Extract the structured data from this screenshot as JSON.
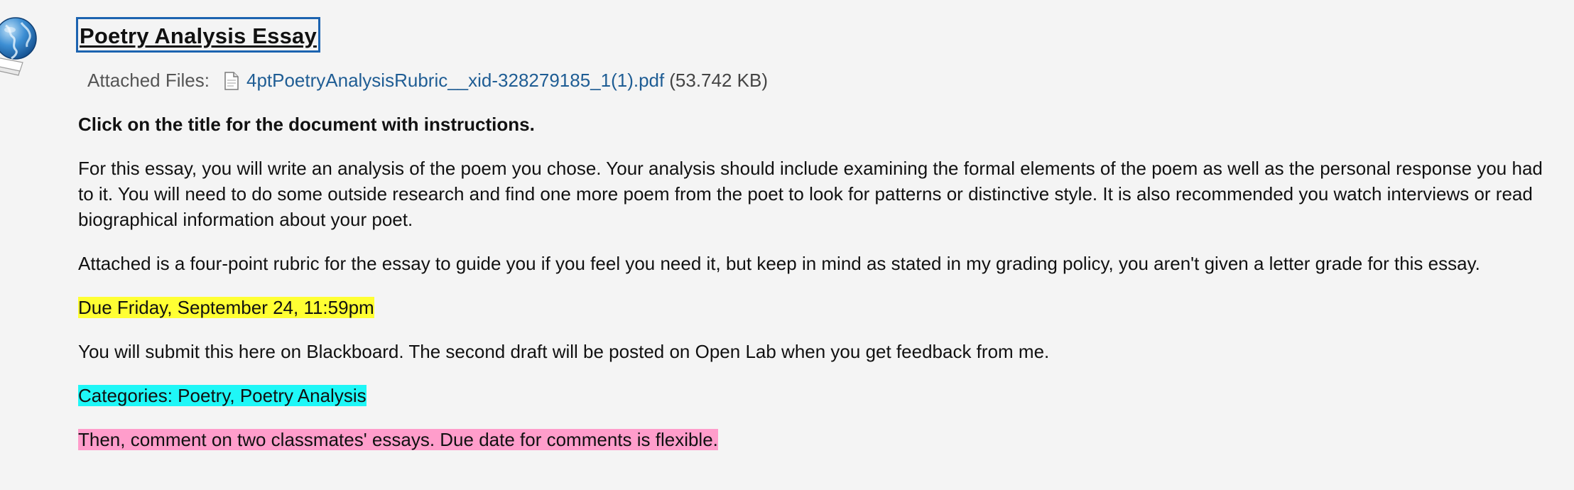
{
  "item": {
    "icon": "globe-document-icon",
    "title": "Poetry Analysis Essay"
  },
  "attachment": {
    "label": "Attached Files:",
    "file_icon": "file-icon",
    "file_name": "4ptPoetryAnalysisRubric__xid-328279185_1(1).pdf",
    "file_size": "(53.742 KB)"
  },
  "body": {
    "instruction": "Click on the title for the document with instructions.",
    "paragraph1": "For this essay, you will write an analysis of the poem you chose. Your analysis should include examining the formal elements of the poem as well as the personal response you had to it. You will need to do some outside research and find one more poem from the poet to look for patterns or distinctive style. It is also recommended you watch interviews or read biographical information about your poet.",
    "paragraph2": "Attached is a four-point rubric for the essay to guide  you if you feel you need it, but keep in mind as stated in my grading policy, you aren't given a letter grade for this essay.",
    "due_date": "Due Friday, September 24, 11:59pm",
    "submission": "You will submit this here on Blackboard. The second draft will be posted on Open Lab when you get feedback from me.",
    "categories": "Categories: Poetry,  Poetry Analysis",
    "comments": "Then,  comment on two classmates' essays. Due date for comments is flexible."
  },
  "colors": {
    "background": "#f4f4f4",
    "link": "#1f5d94",
    "focus_border": "#1c63b0",
    "highlight_yellow": "#ffff33",
    "highlight_cyan": "#1ff7f7",
    "highlight_pink": "#ff9dcb"
  }
}
